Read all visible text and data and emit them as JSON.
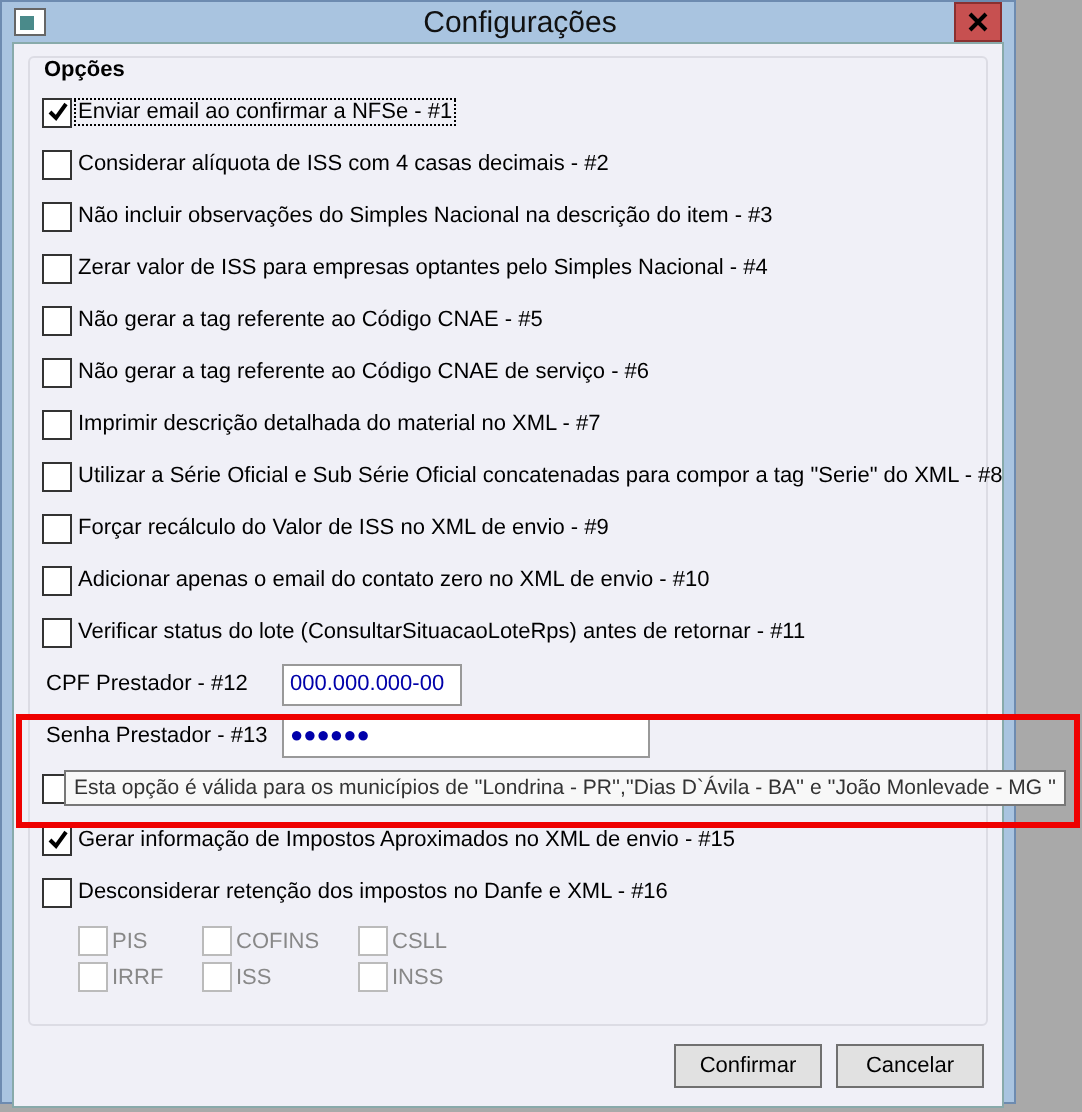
{
  "window": {
    "title": "Configurações"
  },
  "group": {
    "title": "Opções"
  },
  "options": [
    {
      "kind": "checkbox",
      "label": "Enviar email ao confirmar a NFSe - #1",
      "checked": true,
      "focused": true
    },
    {
      "kind": "checkbox",
      "label": "Considerar alíquota de ISS com 4 casas decimais  - #2",
      "checked": false,
      "focused": false
    },
    {
      "kind": "checkbox",
      "label": "Não incluir observações do Simples Nacional na descrição do item - #3",
      "checked": false,
      "focused": false
    },
    {
      "kind": "checkbox",
      "label": "Zerar valor de ISS para empresas optantes pelo Simples Nacional  - #4",
      "checked": false,
      "focused": false
    },
    {
      "kind": "checkbox",
      "label": "Não gerar a tag referente ao Código CNAE  - #5",
      "checked": false,
      "focused": false
    },
    {
      "kind": "checkbox",
      "label": "Não gerar a tag referente ao Código CNAE de serviço  - #6",
      "checked": false,
      "focused": false
    },
    {
      "kind": "checkbox",
      "label": "Imprimir descrição detalhada do material no XML  - #7",
      "checked": false,
      "focused": false
    },
    {
      "kind": "checkbox",
      "label": "Utilizar a Série Oficial e Sub Série Oficial concatenadas para compor a tag \"Serie\" do XML  - #8",
      "checked": false,
      "focused": false
    },
    {
      "kind": "checkbox",
      "label": "Forçar recálculo do Valor de ISS no XML de envio  - #9",
      "checked": false,
      "focused": false
    },
    {
      "kind": "checkbox",
      "label": "Adicionar apenas o email do contato zero no XML de envio  - #10",
      "checked": false,
      "focused": false
    },
    {
      "kind": "checkbox",
      "label": "Verificar status do lote (ConsultarSituacaoLoteRps) antes de retornar  - #11",
      "checked": false,
      "focused": false
    },
    {
      "kind": "text",
      "label": "CPF Prestador - #12",
      "value": "000.000.000-00",
      "wide": false
    },
    {
      "kind": "text",
      "label": "Senha Prestador - #13",
      "value": "●●●●●●",
      "wide": true
    },
    {
      "kind": "checkbox",
      "checked": false,
      "tooltip": "Esta opção é válida para os municípios de ''Londrina - PR'',''Dias D`Ávila - BA'' e ''João Monlevade - MG ''"
    },
    {
      "kind": "checkbox",
      "label": "Gerar informação de Impostos Aproximados no XML de envio  - #15",
      "checked": true,
      "focused": false
    },
    {
      "kind": "checkbox",
      "label": "Desconsiderar retenção dos impostos no Danfe e XML - #16",
      "checked": false,
      "focused": false
    }
  ],
  "taxes": [
    {
      "label": "PIS",
      "checked": false,
      "disabled": true
    },
    {
      "label": "COFINS",
      "checked": false,
      "disabled": true
    },
    {
      "label": "CSLL",
      "checked": false,
      "disabled": true
    },
    {
      "label": "IRRF",
      "checked": false,
      "disabled": true
    },
    {
      "label": "ISS",
      "checked": false,
      "disabled": true
    },
    {
      "label": "INSS",
      "checked": false,
      "disabled": true
    }
  ],
  "buttons": [
    "Confirmar",
    "Cancelar"
  ]
}
